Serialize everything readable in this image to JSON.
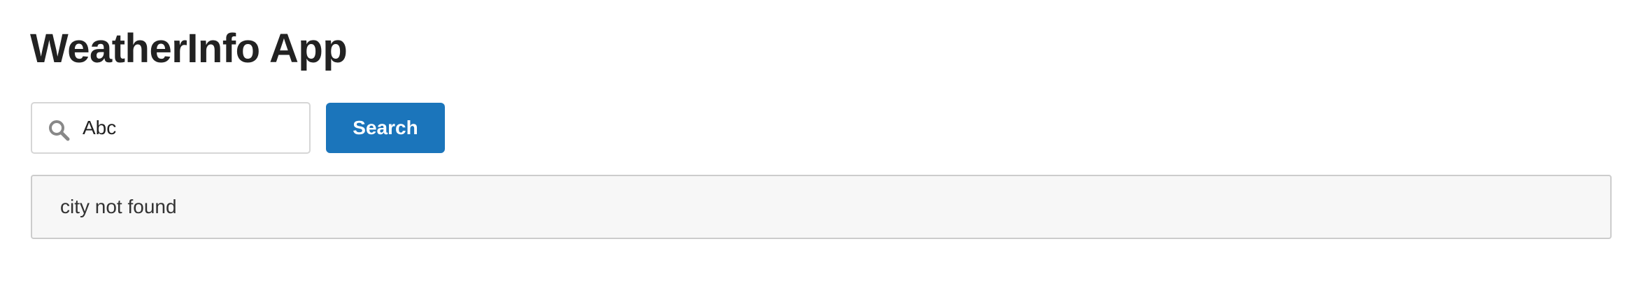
{
  "app": {
    "title": "WeatherInfo App"
  },
  "search": {
    "value": "Abc",
    "placeholder": "",
    "button_label": "Search",
    "icon": "search-icon"
  },
  "result": {
    "message": "city not found"
  },
  "colors": {
    "primary_button": "#1b75bb",
    "panel_background": "#f7f7f7",
    "panel_border": "#cccccc",
    "input_border": "#d6d6d6",
    "icon": "#888888"
  }
}
